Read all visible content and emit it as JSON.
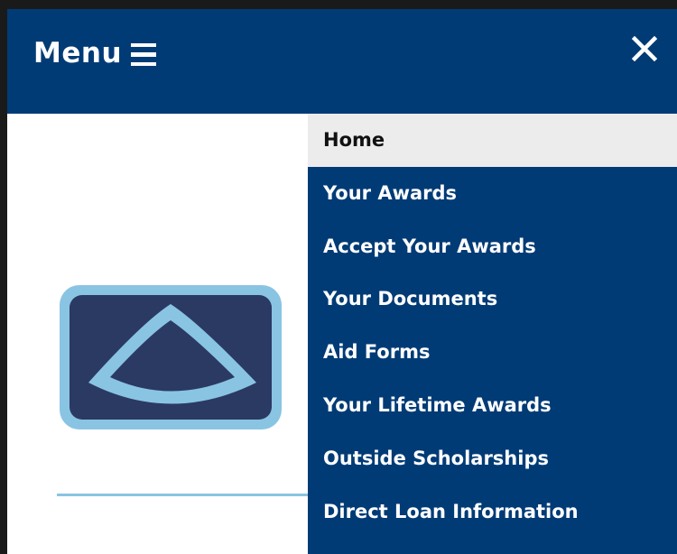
{
  "header": {
    "menu_label": "Menu",
    "menu_icon": "hamburger-icon",
    "close_icon": "close-icon"
  },
  "colors": {
    "header_bg": "#013b76",
    "nav_bg": "#013b76",
    "active_bg": "#ececec",
    "logo_frame": "#8ac4e3",
    "logo_fill": "#2b3a63"
  },
  "nav": {
    "active_index": 0,
    "items": [
      {
        "label": "Home"
      },
      {
        "label": "Your Awards"
      },
      {
        "label": "Accept Your Awards"
      },
      {
        "label": "Your Documents"
      },
      {
        "label": "Aid Forms"
      },
      {
        "label": "Your Lifetime Awards"
      },
      {
        "label": "Outside Scholarships"
      },
      {
        "label": "Direct Loan Information"
      }
    ]
  }
}
